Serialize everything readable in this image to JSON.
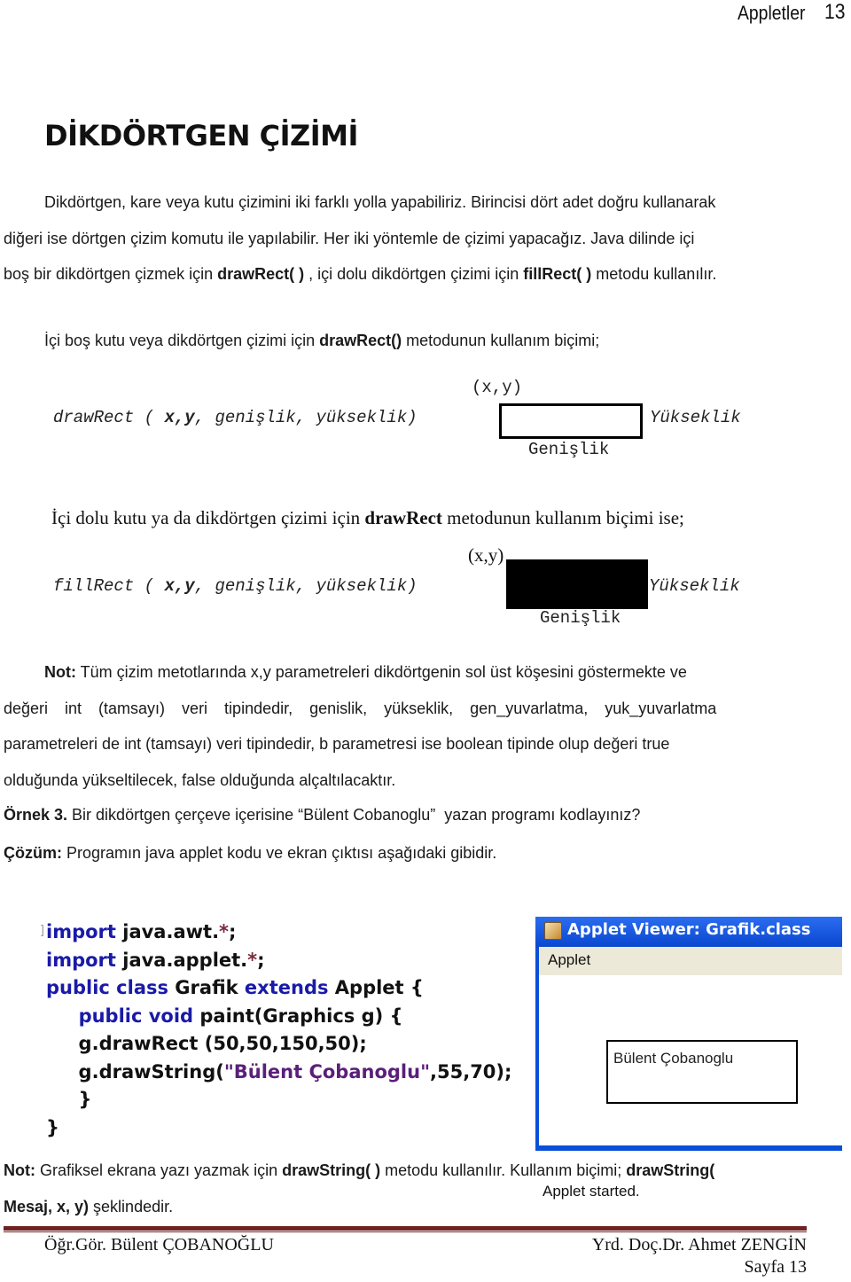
{
  "header": {
    "section_title": "Appletler",
    "page_number": "13"
  },
  "heading": "DİKDÖRTGEN ÇİZİMİ",
  "intro": {
    "line1": "Dikdörtgen, kare veya kutu çizimini iki farklı yolla yapabiliriz. Birincisi dört adet doğru kullanarak",
    "line2": "diğeri ise dörtgen çizim komutu ile yapılabilir. Her iki yöntemle de çizimi yapacağız. Java dilinde içi",
    "line3_pre": "boş bir dikdörtgen çizmek için ",
    "line3_bold1": "drawRect( )",
    "line3_mid": " , içi dolu dikdörtgen çizimi için ",
    "line3_bold2": "fillRect( )",
    "line3_post": " metodu kullanılır."
  },
  "draw_usage": {
    "pre": "İçi boş kutu veya dikdörtgen çizimi için ",
    "bold": "drawRect()",
    "post": " metodunun kullanım biçimi;"
  },
  "figure_draw": {
    "method": "drawRect",
    "open": " ( ",
    "args_bold": "x,y",
    "args_rest": ", genişlik, yükseklik)",
    "xy_label": "(x,y)",
    "height_label": "Yükseklik",
    "width_label": "Genişlik"
  },
  "fill_usage": {
    "pre": "İçi dolu kutu ya da dikdörtgen çizimi için ",
    "bold": "drawRect",
    "post": " metodunun kullanım biçimi ise;"
  },
  "figure_fill": {
    "method": "fillRect",
    "open": " ( ",
    "args_bold": "x,y",
    "args_rest": ", genişlik, yükseklik)",
    "xy_label": "(x,y)",
    "height_label": "Yükseklik",
    "width_label": "Genişlik"
  },
  "note1": {
    "label": "Not:",
    "line1": " Tüm çizim metotlarında x,y parametreleri dikdörtgenin sol üst köşesini göstermekte ve",
    "line2": "değeri int (tamsayı) veri tipindedir, genislik, yükseklik, gen_yuvarlatma, yuk_yuvarlatma",
    "line3": "parametreleri de int (tamsayı) veri tipindedir, b parametresi ise boolean tipinde olup değeri true",
    "line4": "olduğunda yükseltilecek, false olduğunda alçaltılacaktır."
  },
  "example": {
    "label": "Örnek 3.",
    "text": " Bir dikdörtgen çerçeve içerisine “Bülent Cobanoglu”  yazan programı kodlayınız?"
  },
  "solution": {
    "label": "Çözüm:",
    "text": " Programın java applet kodu ve ekran çıktısı aşağıdaki gibidir."
  },
  "code": {
    "l1_kw": "import",
    "l1_rest": " java.awt.",
    "l1_star": "*",
    "l1_end": ";",
    "l2_kw": "import",
    "l2_rest": " java.applet.",
    "l2_star": "*",
    "l2_end": ";",
    "l3_kw1": "public class",
    "l3_name": " Grafik ",
    "l3_kw2": "extends",
    "l3_rest": " Applet {",
    "l4_indent": "     ",
    "l4_kw": "public void",
    "l4_rest": " paint(Graphics g) {",
    "l5": "     g.drawRect (50,50,150,50);",
    "l6_pre": "     g.drawString(",
    "l6_str": "\"Bülent Çobanoglu\"",
    "l6_post": ",55,70);",
    "l7": "     }",
    "l8": "}"
  },
  "applet_window": {
    "title": "Applet Viewer: Grafik.class",
    "menu": "Applet",
    "drawn_text": "Bülent Çobanoglu",
    "status": "Applet started.",
    "title_color": "#0b4fd8"
  },
  "note2": {
    "label": "Not:",
    "text1": " Grafiksel ekrana yazı yazmak için ",
    "bold1": "drawString( )",
    "text2": " metodu kullanılır. Kullanım biçimi; ",
    "bold2": "drawString(",
    "bold3": "Mesaj, x, y)",
    "text3": " şeklindedir."
  },
  "footer": {
    "left": "Öğr.Gör. Bülent ÇOBANOĞLU",
    "right": "Yrd. Doç.Dr. Ahmet ZENGİN",
    "page": "Sayfa 13",
    "rule_color": "#6e2323"
  }
}
